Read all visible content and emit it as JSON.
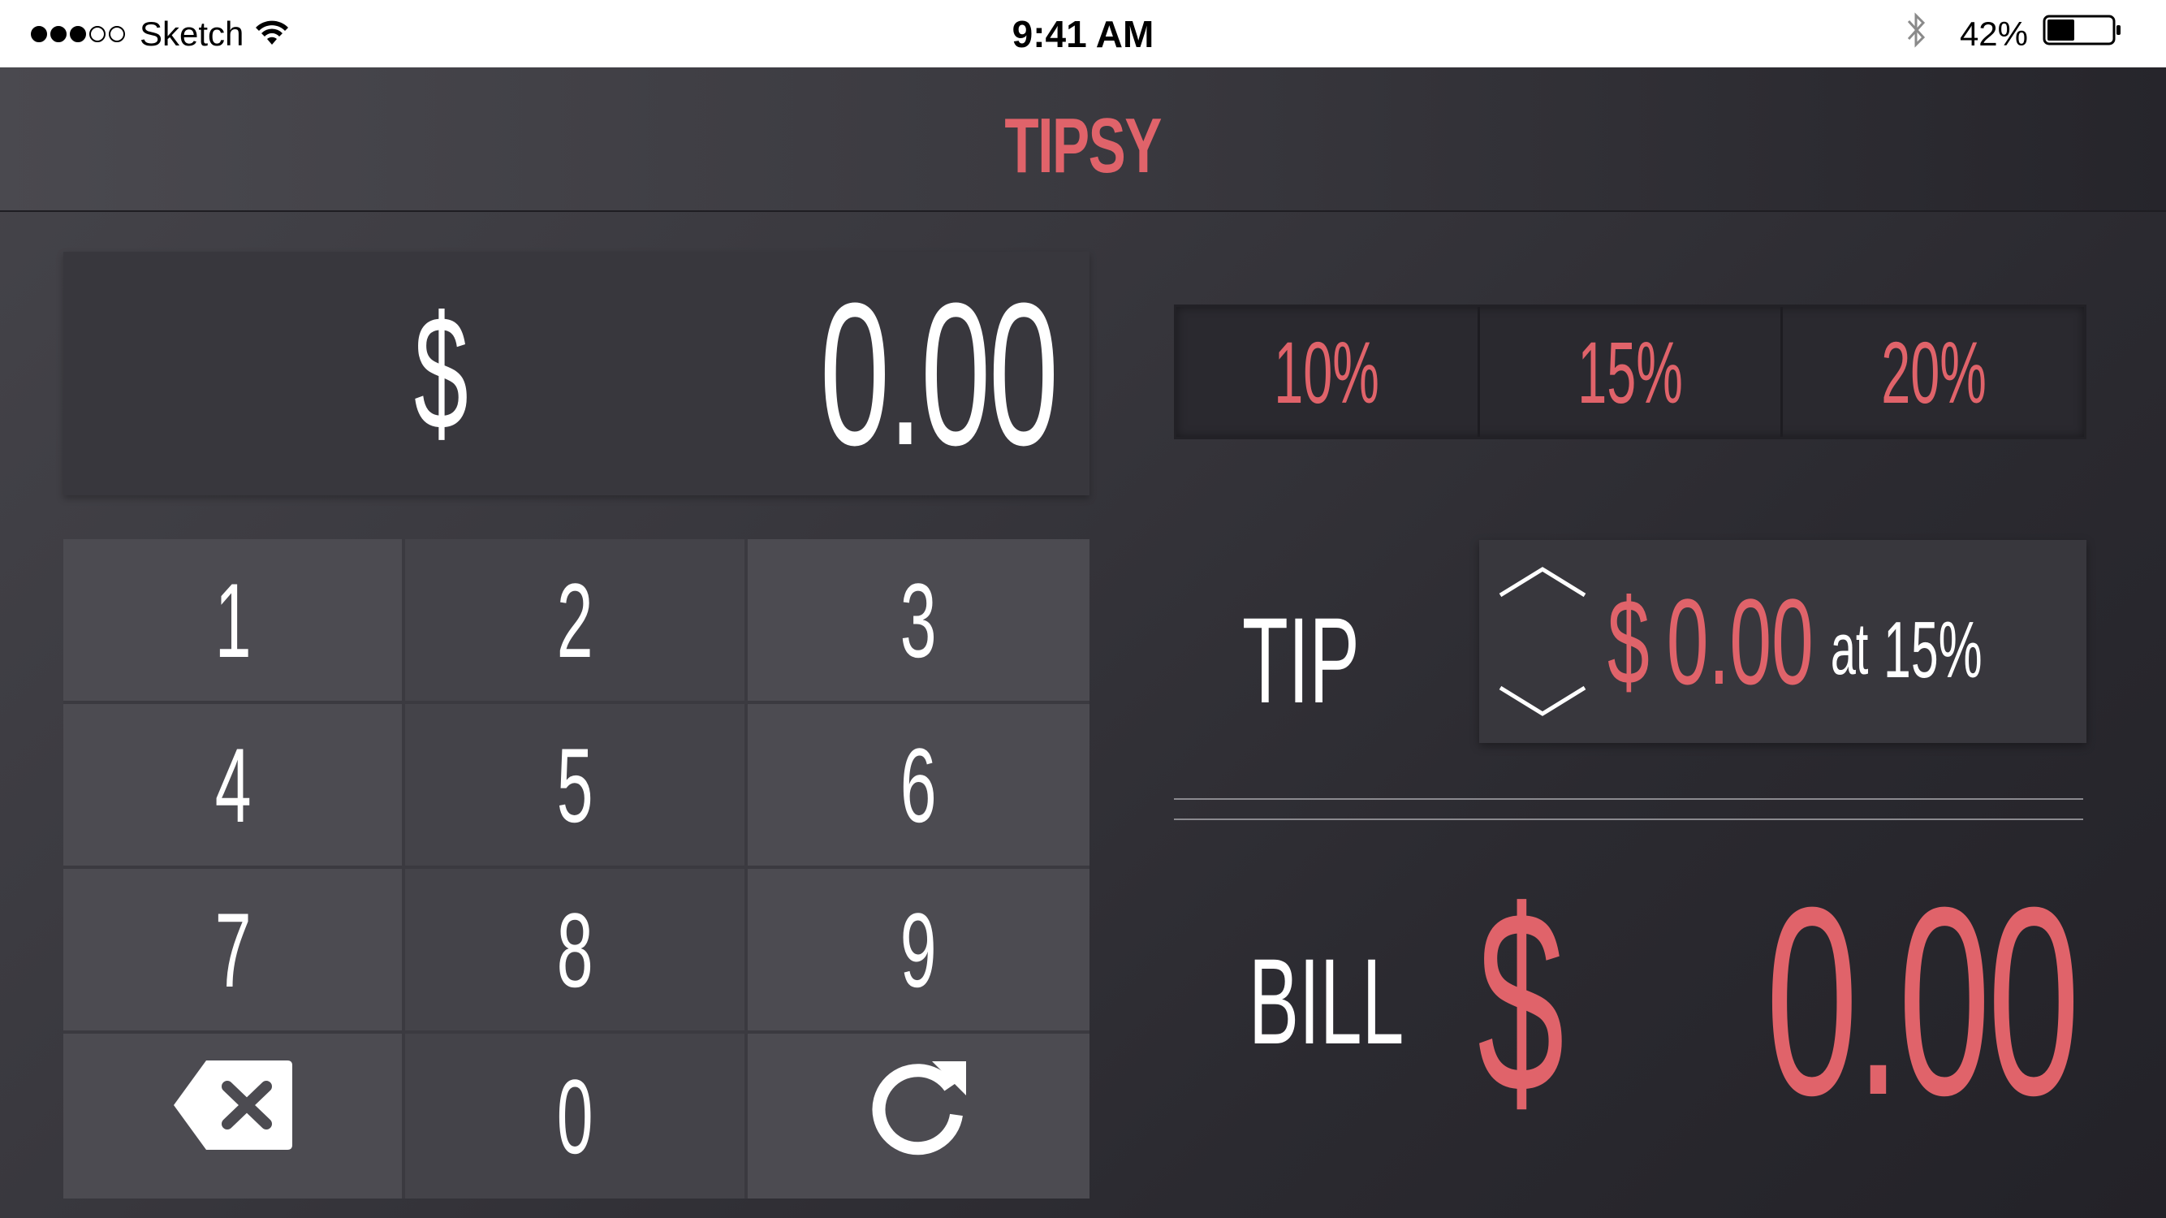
{
  "status_bar": {
    "carrier": "Sketch",
    "time": "9:41 AM",
    "battery_percent": "42%",
    "signal_bars": 3,
    "signal_total": 5,
    "battery_level": 0.42
  },
  "app": {
    "title": "TIPSY",
    "accent_color": "#e0636a"
  },
  "display": {
    "currency": "$",
    "amount": "0.00"
  },
  "keypad": {
    "keys": [
      "1",
      "2",
      "3",
      "4",
      "5",
      "6",
      "7",
      "8",
      "9"
    ],
    "zero": "0",
    "backspace_icon": "backspace-icon",
    "reset_icon": "refresh-icon"
  },
  "tip_options": [
    "10%",
    "15%",
    "20%"
  ],
  "tip": {
    "label": "TIP",
    "currency": "$",
    "amount": "0.00",
    "at": "at",
    "percent": "15%",
    "up_icon": "chevron-up-icon",
    "down_icon": "chevron-down-icon"
  },
  "bill": {
    "label": "BILL",
    "currency": "$",
    "amount": "0.00"
  }
}
